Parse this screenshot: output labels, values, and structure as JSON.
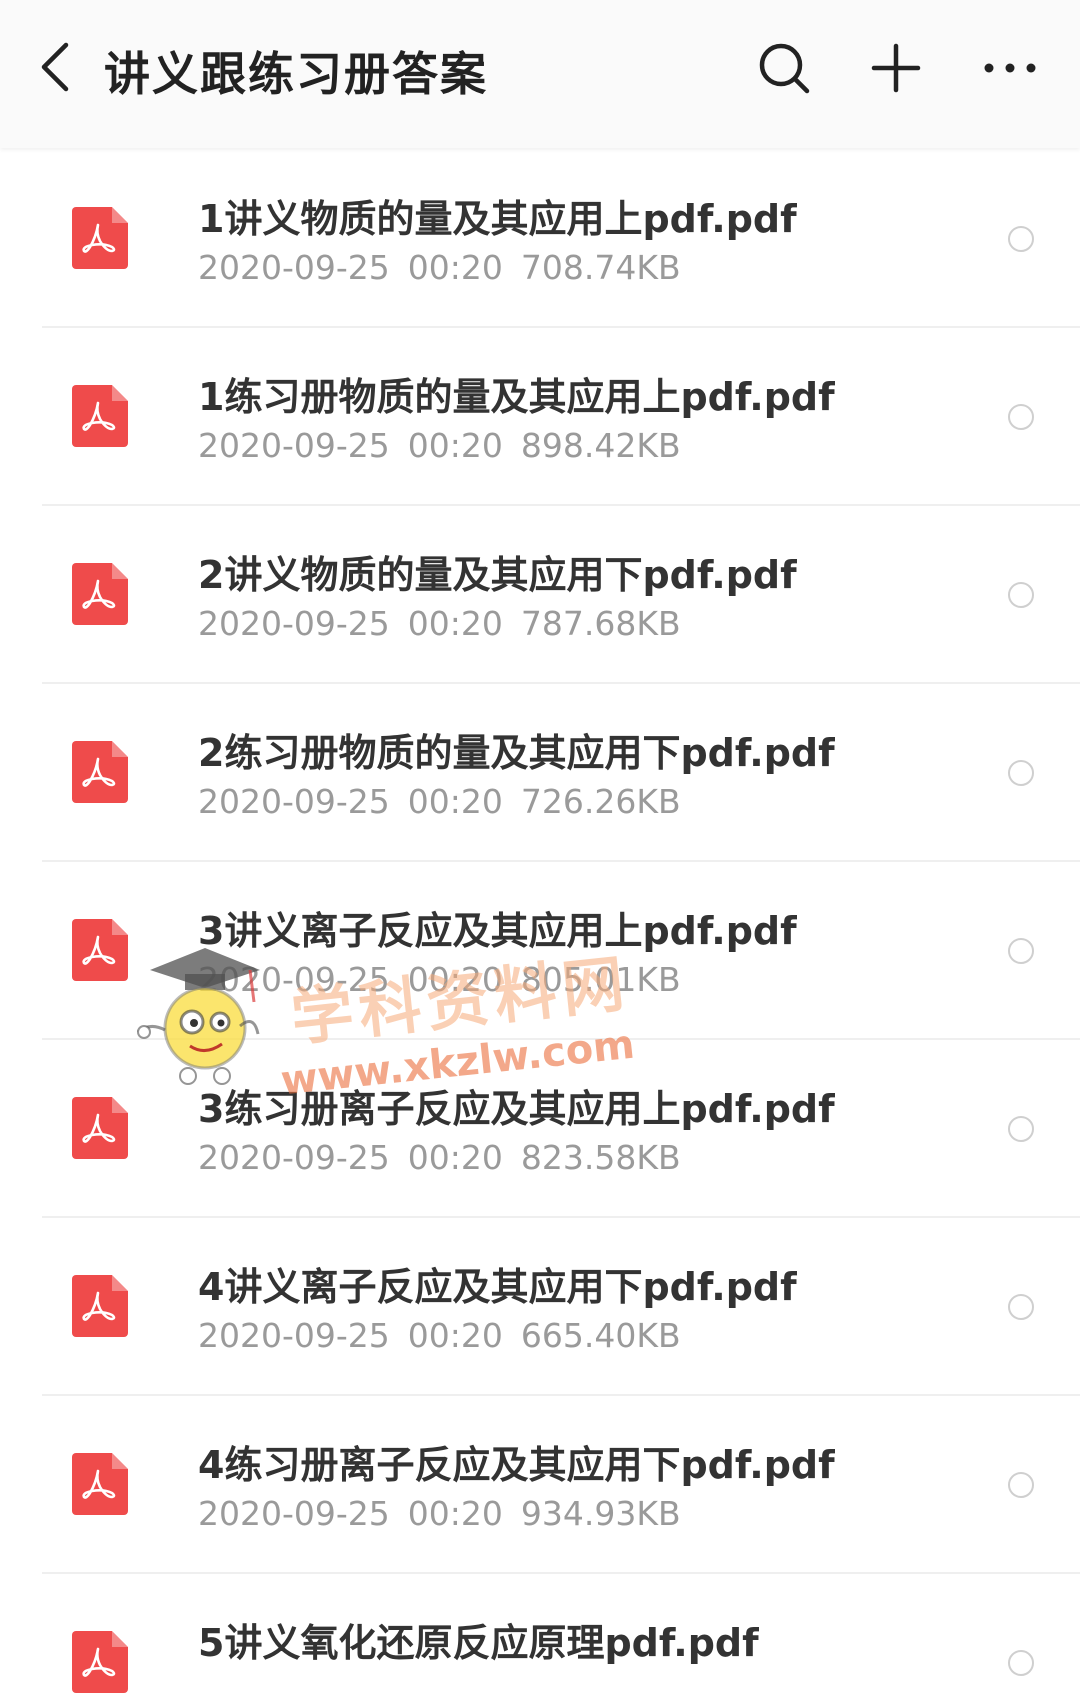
{
  "header": {
    "title": "讲义跟练习册答案",
    "back_icon": "chevron-left-icon",
    "search_icon": "search-icon",
    "add_icon": "plus-icon",
    "more_icon": "more-horizontal-icon"
  },
  "colors": {
    "pdf_red": "#ef4b4b",
    "text_primary": "#333333",
    "text_secondary": "#9a9a9a"
  },
  "files": [
    {
      "name": "1讲义物质的量及其应用上pdf.pdf",
      "date": "2020-09-25",
      "time": "00:20",
      "size": "708.74KB"
    },
    {
      "name": "1练习册物质的量及其应用上pdf.pdf",
      "date": "2020-09-25",
      "time": "00:20",
      "size": "898.42KB"
    },
    {
      "name": "2讲义物质的量及其应用下pdf.pdf",
      "date": "2020-09-25",
      "time": "00:20",
      "size": "787.68KB"
    },
    {
      "name": "2练习册物质的量及其应用下pdf.pdf",
      "date": "2020-09-25",
      "time": "00:20",
      "size": "726.26KB"
    },
    {
      "name": "3讲义离子反应及其应用上pdf.pdf",
      "date": "2020-09-25",
      "time": "00:20",
      "size": "805.01KB"
    },
    {
      "name": "3练习册离子反应及其应用上pdf.pdf",
      "date": "2020-09-25",
      "time": "00:20",
      "size": "823.58KB"
    },
    {
      "name": "4讲义离子反应及其应用下pdf.pdf",
      "date": "2020-09-25",
      "time": "00:20",
      "size": "665.40KB"
    },
    {
      "name": "4练习册离子反应及其应用下pdf.pdf",
      "date": "2020-09-25",
      "time": "00:20",
      "size": "934.93KB"
    },
    {
      "name": "5讲义氧化还原反应原理pdf.pdf",
      "date": "",
      "time": "",
      "size": ""
    }
  ],
  "watermark": {
    "text": "学科资料网",
    "url": "www.xkzlw.com"
  }
}
